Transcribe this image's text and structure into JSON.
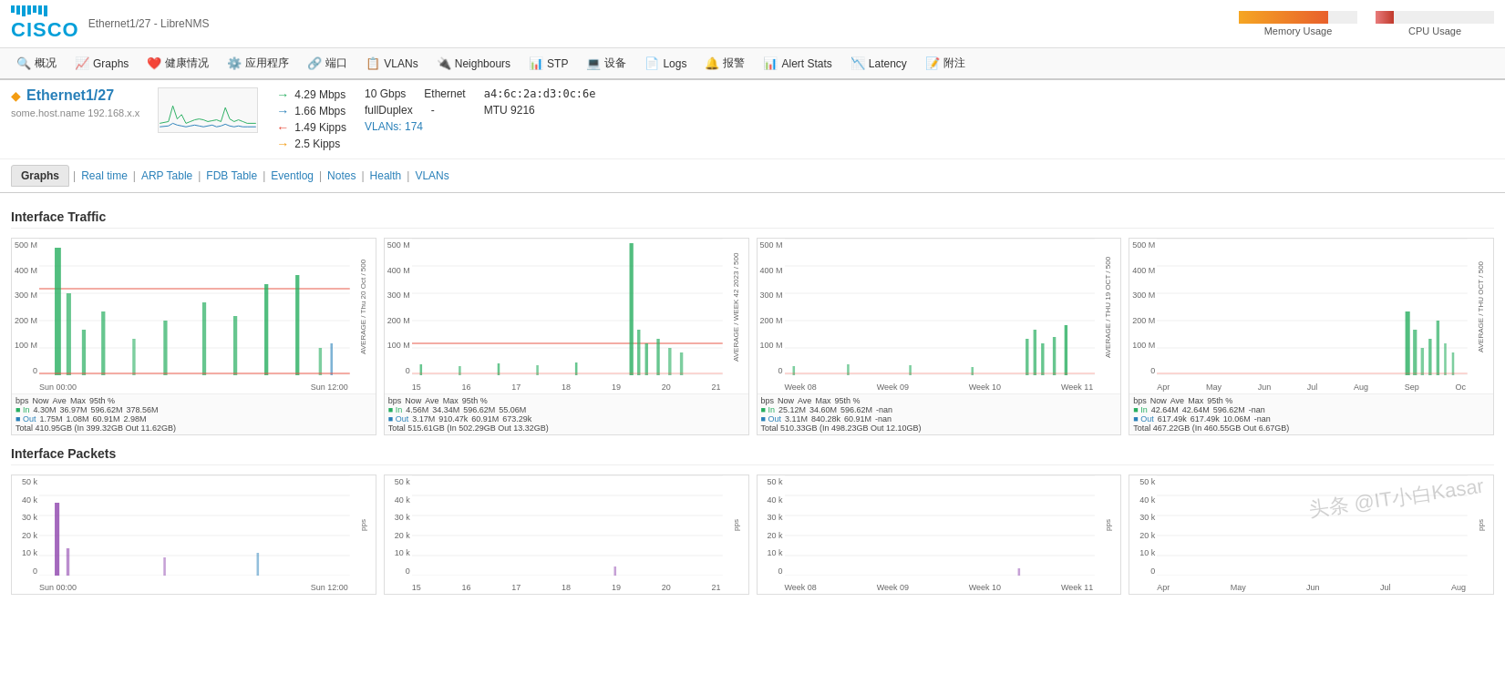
{
  "header": {
    "cisco_label": "CISCO",
    "page_title": "Ethernet1/27 - LibreNMS",
    "memory_usage_label": "Memory Usage",
    "cpu_usage_label": "CPU Usage",
    "memory_pct": 75,
    "cpu_pct": 15
  },
  "nav": {
    "items": [
      {
        "label": "概况",
        "icon": "🔍",
        "id": "overview"
      },
      {
        "label": "Graphs",
        "icon": "📈",
        "id": "graphs"
      },
      {
        "label": "健康情况",
        "icon": "❤️",
        "id": "health"
      },
      {
        "label": "应用程序",
        "icon": "⚙️",
        "id": "apps"
      },
      {
        "label": "端口",
        "icon": "🔗",
        "id": "ports"
      },
      {
        "label": "VLANs",
        "icon": "📋",
        "id": "vlans"
      },
      {
        "label": "Neighbours",
        "icon": "🔌",
        "id": "neighbours"
      },
      {
        "label": "STP",
        "icon": "📊",
        "id": "stp"
      },
      {
        "label": "设备",
        "icon": "💻",
        "id": "devices"
      },
      {
        "label": "Logs",
        "icon": "📄",
        "id": "logs"
      },
      {
        "label": "报警",
        "icon": "🔔",
        "id": "alerts"
      },
      {
        "label": "Alert Stats",
        "icon": "📊",
        "id": "alertstats"
      },
      {
        "label": "Latency",
        "icon": "📉",
        "id": "latency"
      },
      {
        "label": "附注",
        "icon": "📝",
        "id": "notes"
      }
    ]
  },
  "interface": {
    "name": "Ethernet1/27",
    "subtitle": "some.host.name 192.168.x.x",
    "speed_in": "4.29 Mbps",
    "speed_out": "1.66 Mbps",
    "speed_in2": "1.49 Kipps",
    "speed_gold": "2.5 Kipps",
    "capacity": "10 Gbps",
    "duplex": "fullDuplex",
    "vlans": "VLANs: 174",
    "type": "Ethernet",
    "mac": "a4:6c:2a:d3:0c:6e",
    "dash": "-",
    "mtu": "MTU 9216"
  },
  "tabs": {
    "active": "Graphs",
    "items": [
      "Real time",
      "ARP Table",
      "FDB Table",
      "Eventlog",
      "Notes",
      "Health",
      "VLANs"
    ]
  },
  "traffic_section": {
    "title": "Interface Traffic",
    "charts": [
      {
        "id": "day",
        "x_labels": [
          "Sun 00:00",
          "Sun 12:00"
        ],
        "y_labels": [
          "500 M",
          "400 M",
          "300 M",
          "200 M",
          "100 M",
          "0"
        ],
        "right_label": "AVERAGE / Thu 20 Oct / 500",
        "stats": {
          "bps": "bps",
          "in_now": "4.30M",
          "in_ave": "36.97M",
          "in_max": "596.62M",
          "in_95": "378.56M",
          "out_now": "1.75M",
          "out_ave": "1.08M",
          "out_max": "60.91M",
          "out_95": "2.98M",
          "total": "Total 410.95GB (In 399.32GB  Out 11.62GB)"
        }
      },
      {
        "id": "week",
        "x_labels": [
          "15",
          "16",
          "17",
          "18",
          "19",
          "20",
          "21"
        ],
        "y_labels": [
          "500 M",
          "400 M",
          "300 M",
          "200 M",
          "100 M",
          "0"
        ],
        "right_label": "AVERAGE / WEEK 42 2023 / 500",
        "stats": {
          "bps": "bps",
          "in_now": "4.56M",
          "in_ave": "34.34M",
          "in_max": "596.62M",
          "in_95": "55.06M",
          "out_now": "3.17M",
          "out_ave": "910.47k",
          "out_max": "60.91M",
          "out_95": "673.29k",
          "total": "Total 515.61GB (In 502.29GB  Out 13.32GB)"
        }
      },
      {
        "id": "month",
        "x_labels": [
          "Week 08",
          "Week 09",
          "Week 10",
          "Week 11"
        ],
        "y_labels": [
          "500 M",
          "400 M",
          "300 M",
          "200 M",
          "100 M",
          "0"
        ],
        "right_label": "AVERAGE / THU 19 OCT / 500",
        "stats": {
          "bps": "bps",
          "in_now": "25.12M",
          "in_ave": "34.60M",
          "in_max": "596.62M",
          "in_95": "-nan",
          "out_now": "3.11M",
          "out_ave": "840.28k",
          "out_max": "60.91M",
          "out_95": "-nan",
          "total": "Total 510.33GB (In 498.23GB  Out 12.10GB)"
        }
      },
      {
        "id": "year",
        "x_labels": [
          "Apr",
          "May",
          "Jun",
          "Jul",
          "Aug",
          "Sep",
          "Oc"
        ],
        "y_labels": [
          "500 M",
          "400 M",
          "300 M",
          "200 M",
          "100 M",
          "0"
        ],
        "right_label": "AVERAGE / THU OCT / 500",
        "stats": {
          "bps": "bps",
          "in_now": "42.64M",
          "in_ave": "42.64M",
          "in_max": "596.62M",
          "in_95": "-nan",
          "out_now": "617.49k",
          "out_ave": "617.49k",
          "out_max": "10.06M",
          "out_95": "-nan",
          "total": "Total 467.22GB (In 460.55GB  Out 6.67GB)"
        }
      }
    ]
  },
  "packets_section": {
    "title": "Interface Packets",
    "charts": [
      {
        "id": "pkt_day",
        "x_labels": [
          "Sun 00:00",
          "Sun 12:00"
        ],
        "y_labels": [
          "50 k",
          "40 k",
          "30 k",
          "20 k",
          "10 k",
          "0"
        ]
      },
      {
        "id": "pkt_week",
        "x_labels": [
          "15",
          "16",
          "17",
          "18",
          "19",
          "20",
          "21"
        ],
        "y_labels": [
          "50 k",
          "40 k",
          "30 k",
          "20 k",
          "10 k",
          "0"
        ]
      },
      {
        "id": "pkt_month",
        "x_labels": [
          "Week 08",
          "Week 09",
          "Week 10",
          "Week 11"
        ],
        "y_labels": [
          "50 k",
          "40 k",
          "30 k",
          "20 k",
          "10 k",
          "0"
        ]
      },
      {
        "id": "pkt_year",
        "x_labels": [
          "Apr",
          "May",
          "Jun",
          "Jul",
          "Aug"
        ],
        "y_labels": [
          "50 k",
          "40 k",
          "30 k",
          "20 k",
          "10 k",
          "0"
        ]
      }
    ]
  }
}
